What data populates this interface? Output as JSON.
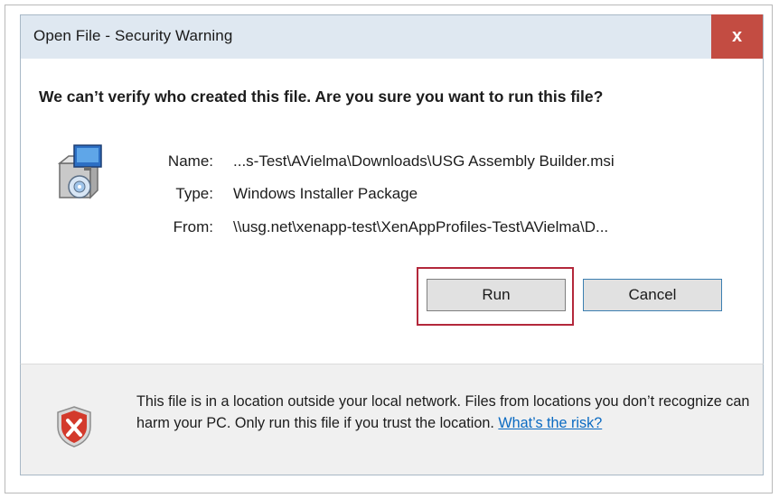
{
  "window": {
    "title": "Open File - Security Warning",
    "close_glyph": "x"
  },
  "headline": "We can’t verify who created this file. Are you sure you want to run this file?",
  "icons": {
    "package": "installer-package-icon",
    "shield": "security-shield-error-icon"
  },
  "details": {
    "name_label": "Name:",
    "name_value": "...s-Test\\AVielma\\Downloads\\USG Assembly Builder.msi",
    "type_label": "Type:",
    "type_value": "Windows Installer Package",
    "from_label": "From:",
    "from_value": "\\\\usg.net\\xenapp-test\\XenAppProfiles-Test\\AVielma\\D..."
  },
  "buttons": {
    "run": "Run",
    "cancel": "Cancel"
  },
  "warning": {
    "text": "This file is in a location outside your local network. Files from locations you don’t recognize can harm your PC. Only run this file if you trust the location.",
    "link": "What’s the risk?"
  },
  "colors": {
    "close_button": "#c34c42",
    "highlight_border": "#b3283b",
    "link": "#0a6ac2",
    "title_bar": "#dfe8f1"
  }
}
